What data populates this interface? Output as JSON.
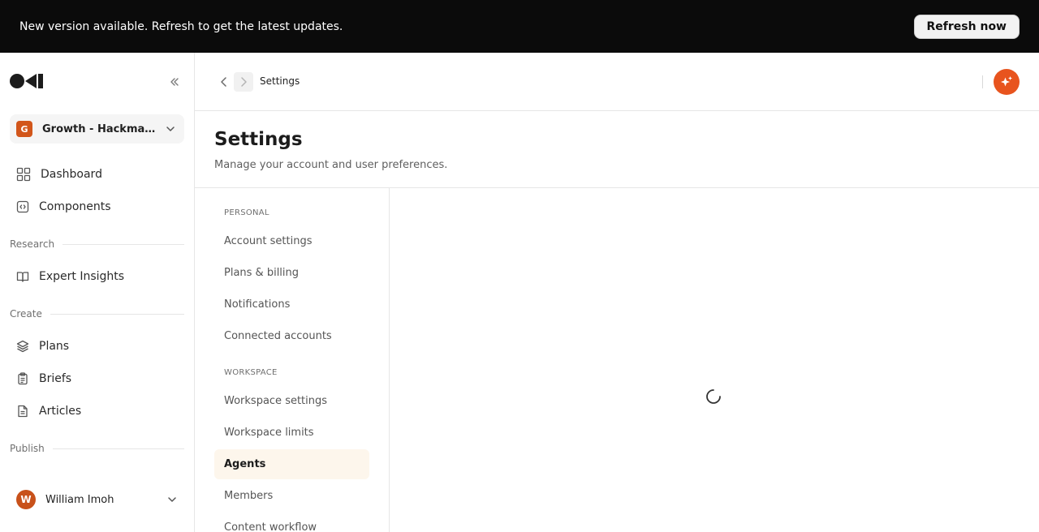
{
  "banner": {
    "message": "New version available. Refresh to get the latest updates.",
    "refresh_label": "Refresh now"
  },
  "sidebar": {
    "workspace": {
      "initial": "G",
      "name": "Growth - Hackmamba"
    },
    "items_top": [
      {
        "label": "Dashboard",
        "icon": "grid-icon"
      },
      {
        "label": "Components",
        "icon": "code-box-icon"
      }
    ],
    "sections": [
      {
        "label": "Research",
        "items": [
          {
            "label": "Expert Insights",
            "icon": "book-open-icon"
          }
        ]
      },
      {
        "label": "Create",
        "items": [
          {
            "label": "Plans",
            "icon": "layers-icon"
          },
          {
            "label": "Briefs",
            "icon": "clipboard-icon"
          },
          {
            "label": "Articles",
            "icon": "file-text-icon"
          }
        ]
      },
      {
        "label": "Publish",
        "items": []
      }
    ],
    "user": {
      "initial": "W",
      "name": "William Imoh"
    }
  },
  "topbar": {
    "breadcrumb": "Settings"
  },
  "header": {
    "title": "Settings",
    "subtitle": "Manage your account and user preferences."
  },
  "settings_nav": {
    "personal_label": "PERSONAL",
    "personal_items": [
      "Account settings",
      "Plans & billing",
      "Notifications",
      "Connected accounts"
    ],
    "workspace_label": "WORKSPACE",
    "workspace_items": [
      "Workspace settings",
      "Workspace limits",
      "Agents",
      "Members",
      "Content workflow"
    ],
    "active_item": "Agents"
  },
  "colors": {
    "accent": "#e8541e",
    "workspace_badge": "#d2561b",
    "active_bg": "#fdf6ec"
  }
}
